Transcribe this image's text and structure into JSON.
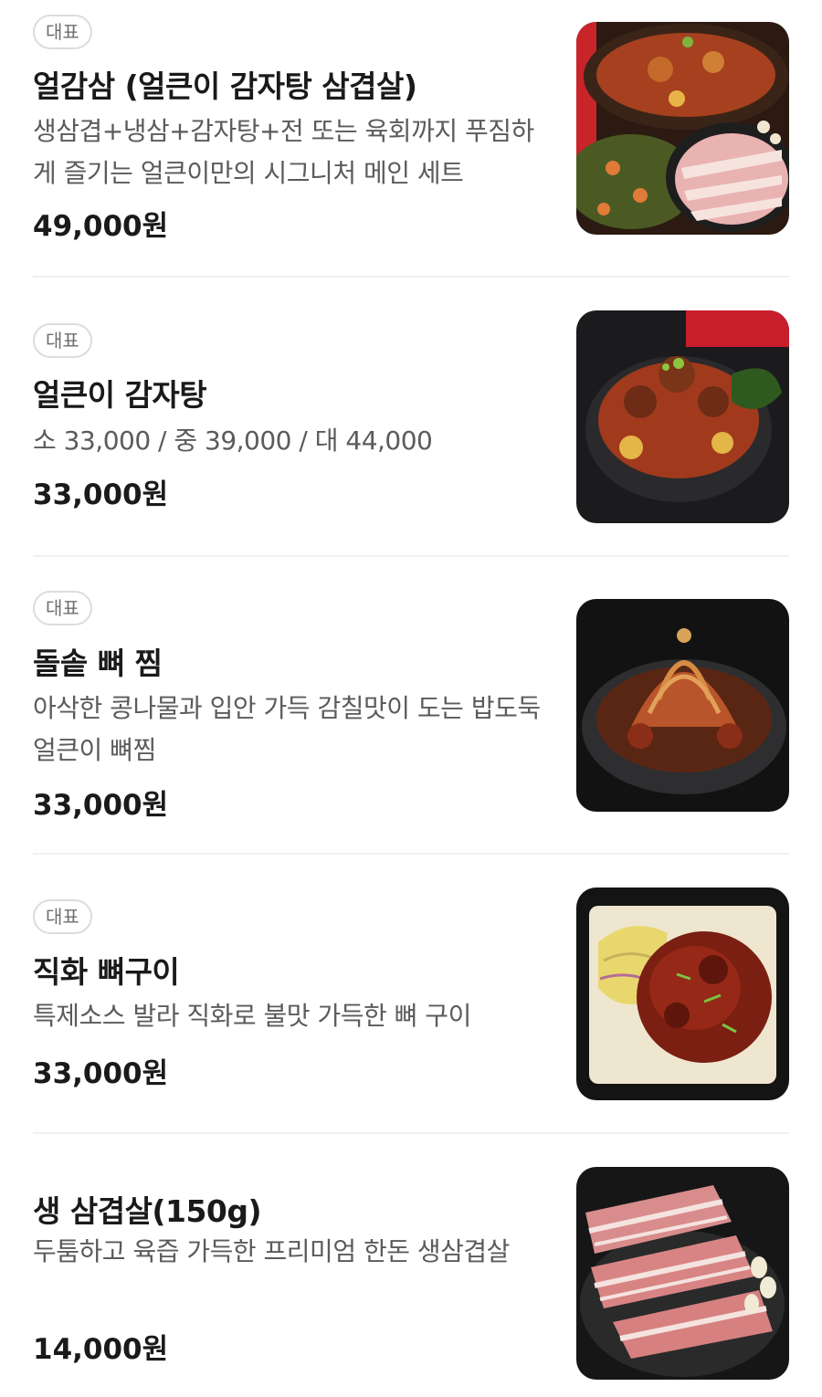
{
  "menu": {
    "items": [
      {
        "badge": "대표",
        "name": "얼감삼 (얼큰이 감자탕 삼겹살)",
        "description": "생삼겹+냉삼+감자탕+전 또는 육회까지 푸짐하게 즐기는 얼큰이만의 시그니처 메인 세트",
        "price": "49,000원",
        "image_icon": "gamjatang-samgyeopsal-set-photo"
      },
      {
        "badge": "대표",
        "name": "얼큰이 감자탕",
        "description": "소 33,000 / 중 39,000 / 대 44,000",
        "price": "33,000원",
        "image_icon": "gamjatang-photo"
      },
      {
        "badge": "대표",
        "name": "돌솥 뼈 찜",
        "description": "아삭한 콩나물과 입안 가득 감칠맛이 도는 밥도둑 얼큰이 뼈찜",
        "price": "33,000원",
        "image_icon": "ppyeo-jjim-photo"
      },
      {
        "badge": "대표",
        "name": "직화 뼈구이",
        "description": "특제소스 발라 직화로 불맛 가득한 뼈 구이",
        "price": "33,000원",
        "image_icon": "ppyeo-gui-photo"
      },
      {
        "badge": "",
        "name": "생 삼겹살(150g)",
        "description": "두툼하고 육즙 가득한 프리미엄 한돈 생삼겹살",
        "price": "14,000원",
        "image_icon": "samgyeopsal-photo"
      }
    ]
  }
}
